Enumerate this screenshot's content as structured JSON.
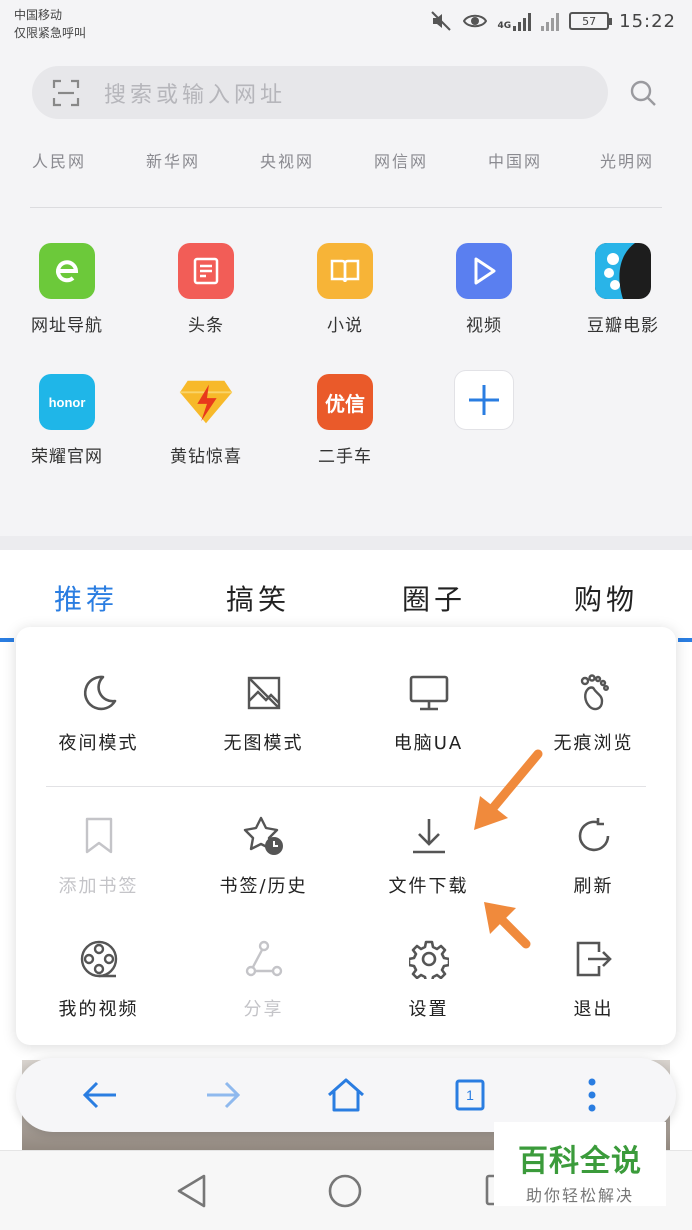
{
  "status": {
    "carrier_line1": "中国移动",
    "carrier_line2": "仅限紧急呼叫",
    "network": "4G",
    "battery": "57",
    "time": "15:22"
  },
  "search": {
    "placeholder": "搜索或输入网址"
  },
  "quicklinks": [
    "人民网",
    "新华网",
    "央视网",
    "网信网",
    "中国网",
    "光明网"
  ],
  "apps": [
    {
      "label": "网址导航",
      "icon": "e-icon",
      "color": "#6cc93a"
    },
    {
      "label": "头条",
      "icon": "news-icon",
      "color": "#f25d57"
    },
    {
      "label": "小说",
      "icon": "book-icon",
      "color": "#f7b437"
    },
    {
      "label": "视频",
      "icon": "play-icon",
      "color": "#5a7ff0"
    },
    {
      "label": "豆瓣电影",
      "icon": "film-icon",
      "color": "#1d1d1d"
    },
    {
      "label": "荣耀官网",
      "icon": "honor-icon",
      "color": "#1fb6e8",
      "logo_text": "honor"
    },
    {
      "label": "黄钻惊喜",
      "icon": "diamond-icon",
      "color": "#f7b92a"
    },
    {
      "label": "二手车",
      "icon": "car-icon",
      "color": "#ea5a2a",
      "logo_text": "优信"
    },
    {
      "label": "",
      "icon": "add-icon",
      "color": "#2a7de1"
    }
  ],
  "tabs": [
    "推荐",
    "搞笑",
    "圈子",
    "购物"
  ],
  "menu": [
    {
      "label": "夜间模式",
      "icon": "moon-icon",
      "disabled": false
    },
    {
      "label": "无图模式",
      "icon": "no-image-icon",
      "disabled": false
    },
    {
      "label": "电脑UA",
      "icon": "desktop-icon",
      "disabled": false
    },
    {
      "label": "无痕浏览",
      "icon": "footprint-icon",
      "disabled": false
    },
    {
      "label": "添加书签",
      "icon": "bookmark-icon",
      "disabled": true
    },
    {
      "label": "书签/历史",
      "icon": "star-clock-icon",
      "disabled": false
    },
    {
      "label": "文件下载",
      "icon": "download-icon",
      "disabled": false
    },
    {
      "label": "刷新",
      "icon": "refresh-icon",
      "disabled": false
    },
    {
      "label": "我的视频",
      "icon": "film-reel-icon",
      "disabled": false
    },
    {
      "label": "分享",
      "icon": "share-icon",
      "disabled": true
    },
    {
      "label": "设置",
      "icon": "gear-icon",
      "disabled": false
    },
    {
      "label": "退出",
      "icon": "exit-icon",
      "disabled": false
    }
  ],
  "toolbar": {
    "tab_count": "1"
  },
  "watermark": {
    "title": "百科全说",
    "subtitle": "助你轻松解决"
  },
  "colors": {
    "accent": "#2a7de1",
    "annotation_arrow": "#f08a3c"
  }
}
